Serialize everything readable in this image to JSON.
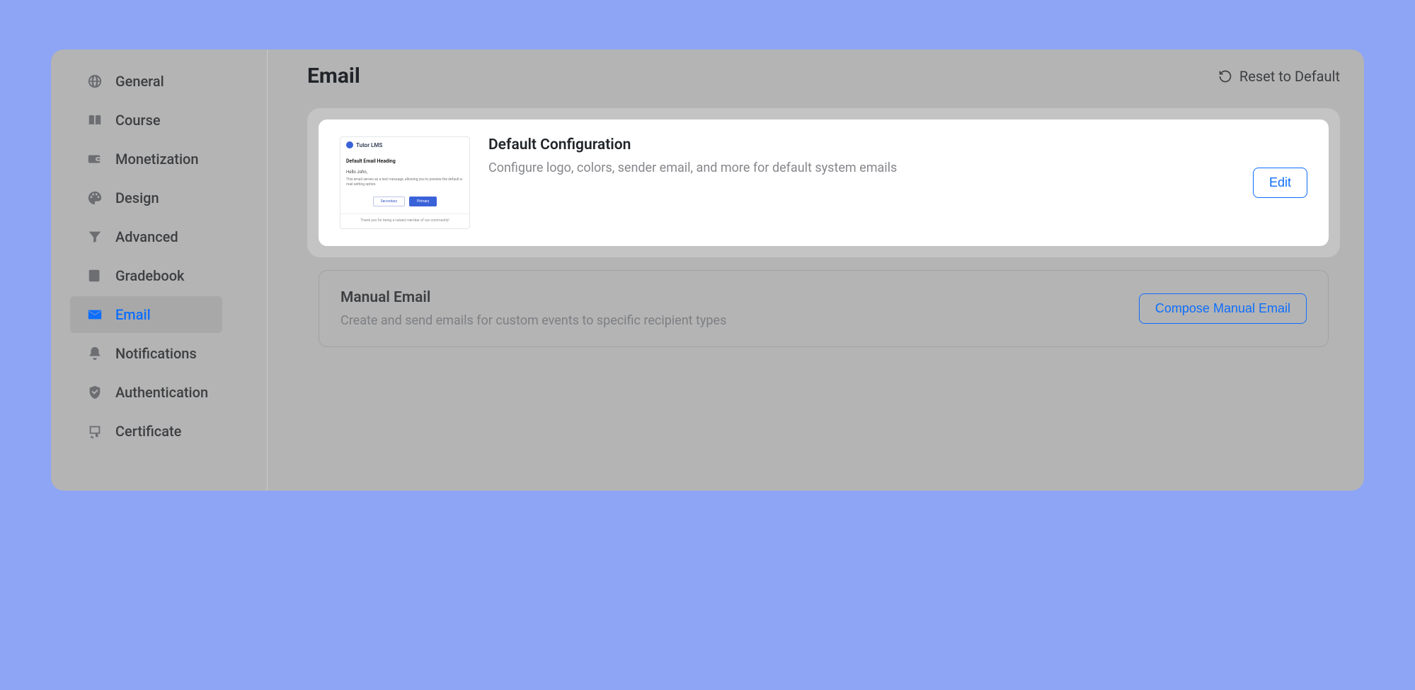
{
  "sidebar": {
    "items": [
      {
        "label": "General",
        "icon": "globe-icon",
        "active": false
      },
      {
        "label": "Course",
        "icon": "book-icon",
        "active": false
      },
      {
        "label": "Monetization",
        "icon": "wallet-icon",
        "active": false
      },
      {
        "label": "Design",
        "icon": "palette-icon",
        "active": false
      },
      {
        "label": "Advanced",
        "icon": "funnel-icon",
        "active": false
      },
      {
        "label": "Gradebook",
        "icon": "gradebook-icon",
        "active": false
      },
      {
        "label": "Email",
        "icon": "envelope-icon",
        "active": true
      },
      {
        "label": "Notifications",
        "icon": "bell-icon",
        "active": false
      },
      {
        "label": "Authentication",
        "icon": "shield-icon",
        "active": false
      },
      {
        "label": "Certificate",
        "icon": "certificate-icon",
        "active": false
      }
    ]
  },
  "header": {
    "title": "Email",
    "reset_label": "Reset to Default"
  },
  "default_config": {
    "title": "Default Configuration",
    "desc": "Configure logo, colors, sender email, and more for default system emails",
    "edit_label": "Edit",
    "preview": {
      "brand": "Tutor LMS",
      "heading": "Default Email Heading",
      "greet": "Hello John,",
      "body": "This email serves as a test message, allowing you to preview the default e-mail setting option.",
      "secondary": "Secondary",
      "primary": "Primary",
      "footer": "Thank you for being a valued member of our community!"
    }
  },
  "manual_email": {
    "title": "Manual Email",
    "desc": "Create and send emails for custom events to specific recipient types",
    "action_label": "Compose Manual Email"
  }
}
